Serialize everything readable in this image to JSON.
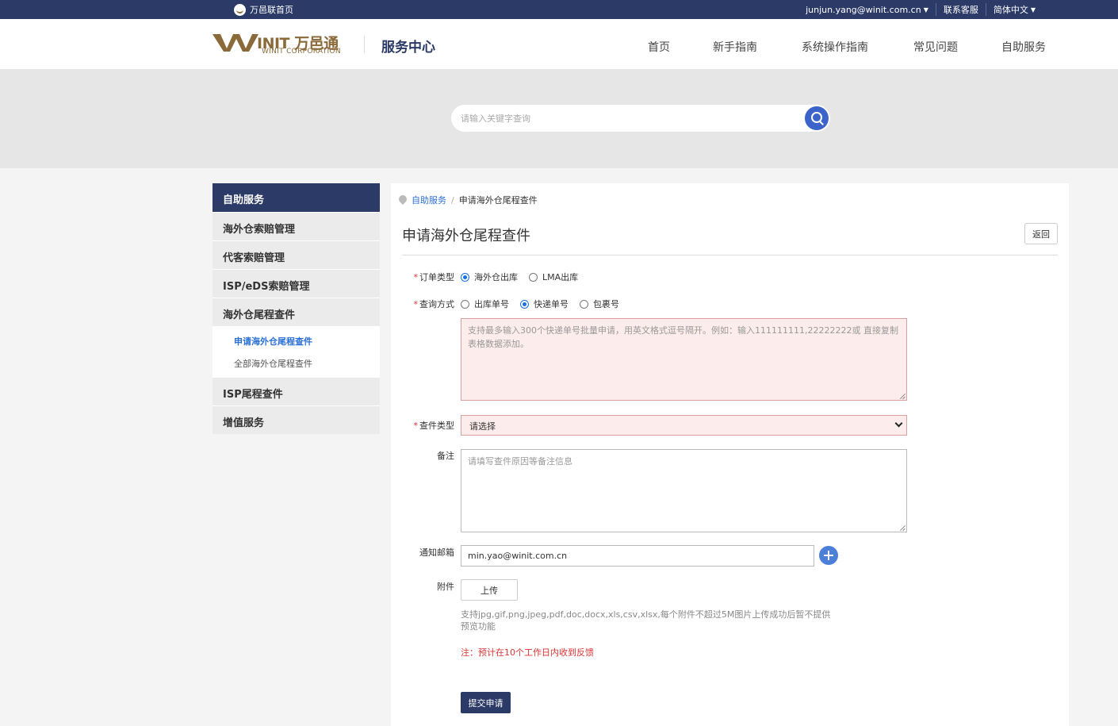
{
  "topbar": {
    "home_label": "万邑联首页",
    "user": "junjun.yang@winit.com.cn",
    "contact": "联系客服",
    "language": "简体中文"
  },
  "header": {
    "logo_text": "INIT 万邑通",
    "logo_sub": "WINIT CORPORATION",
    "title": "服务中心",
    "nav": [
      "首页",
      "新手指南",
      "系统操作指南",
      "常见问题",
      "自助服务"
    ]
  },
  "search": {
    "placeholder": "请输入关键字查询"
  },
  "sidebar": {
    "head": "自助服务",
    "items": [
      "海外仓索赔管理",
      "代客索赔管理",
      "ISP/eDS索赔管理",
      "海外仓尾程查件"
    ],
    "sub_items": [
      "申请海外仓尾程查件",
      "全部海外仓尾程查件"
    ],
    "items_after": [
      "ISP尾程查件",
      "增值服务"
    ]
  },
  "breadcrumb": {
    "root": "自助服务",
    "sep": "/",
    "current": "申请海外仓尾程查件"
  },
  "page": {
    "title": "申请海外仓尾程查件",
    "back_label": "返回"
  },
  "form": {
    "order_type": {
      "label": "订单类型",
      "options": [
        "海外仓出库",
        "LMA出库"
      ],
      "selected": 0
    },
    "query_method": {
      "label": "查询方式",
      "options": [
        "出库单号",
        "快递单号",
        "包裹号"
      ],
      "selected": 1
    },
    "numbers_placeholder": "支持最多输入300个快递单号批量申请，用英文格式逗号隔开。例如：输入111111111,22222222或 直接复制表格数据添加。",
    "query_type": {
      "label": "查件类型",
      "value": "请选择"
    },
    "remark": {
      "label": "备注",
      "placeholder": "请填写查件原因等备注信息"
    },
    "email": {
      "label": "通知邮箱",
      "value": "min.yao@winit.com.cn"
    },
    "attachment": {
      "label": "附件",
      "upload_label": "上传",
      "hint": "支持jpg,gif,png,jpeg,pdf,doc,docx,xls,csv,xlsx,每个附件不超过5M图片上传成功后暂不提供预览功能"
    },
    "note": "注：预计在10个工作日内收到反馈",
    "submit_label": "提交申请"
  },
  "colors": {
    "navy": "#2b3a66",
    "link": "#2a6fd6",
    "gold": "#8b6a3a",
    "error_bg": "#fdecec",
    "required": "#dd3333"
  }
}
